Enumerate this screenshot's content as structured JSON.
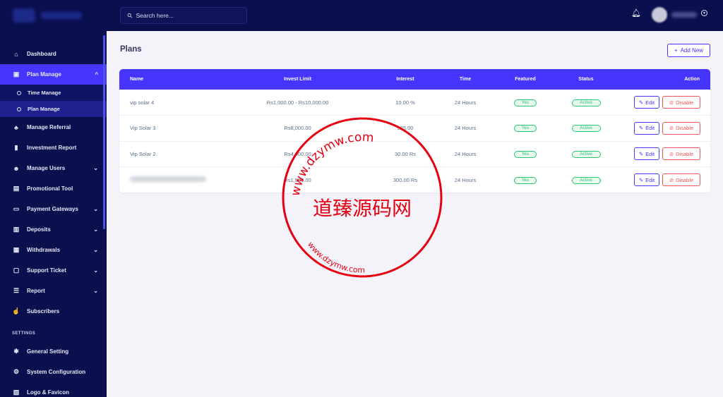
{
  "sidebar": {
    "items": [
      {
        "label": "Dashboard",
        "icon": "home-icon",
        "glyph": "⌂"
      },
      {
        "label": "Plan Manage",
        "icon": "clipboard-icon",
        "glyph": "▣",
        "caret": "^"
      },
      {
        "label": "Manage Referral",
        "icon": "tree-icon",
        "glyph": "♣"
      },
      {
        "label": "Investment Report",
        "icon": "chart-bars-icon",
        "glyph": "▮"
      },
      {
        "label": "Manage Users",
        "icon": "users-icon",
        "glyph": "☻",
        "caret": "⌄"
      },
      {
        "label": "Promotional Tool",
        "icon": "ad-icon",
        "glyph": "▤"
      },
      {
        "label": "Payment Gateways",
        "icon": "credit-card-icon",
        "glyph": "▭",
        "caret": "⌄"
      },
      {
        "label": "Deposits",
        "icon": "file-invoice-icon",
        "glyph": "▥",
        "caret": "⌄"
      },
      {
        "label": "Withdrawals",
        "icon": "bank-icon",
        "glyph": "▦",
        "caret": "⌄"
      },
      {
        "label": "Support Ticket",
        "icon": "ticket-icon",
        "glyph": "▢",
        "caret": "⌄"
      },
      {
        "label": "Report",
        "icon": "list-icon",
        "glyph": "☰",
        "caret": "⌄"
      },
      {
        "label": "Subscribers",
        "icon": "thumbs-up-icon",
        "glyph": "☝"
      }
    ],
    "submenu": [
      {
        "label": "Time Manage"
      },
      {
        "label": "Plan Manage"
      }
    ],
    "settings_label": "SETTINGS",
    "settings": [
      {
        "label": "General Setting",
        "icon": "gear-icon",
        "glyph": "✱"
      },
      {
        "label": "System Configuration",
        "icon": "cog-icon",
        "glyph": "⚙"
      },
      {
        "label": "Logo & Favicon",
        "icon": "image-icon",
        "glyph": "▧"
      }
    ]
  },
  "topbar": {
    "search_placeholder": "Search here...",
    "search_icon": "search-icon",
    "bell_icon": "bell-icon"
  },
  "page": {
    "title": "Plans",
    "add_new_label": "Add New",
    "add_new_icon": "plus-icon"
  },
  "table": {
    "headers": {
      "name": "Name",
      "invest_limit": "Invest Limit",
      "interest": "Interest",
      "time": "Time",
      "featured": "Featured",
      "status": "Status",
      "action": "Action"
    },
    "rows": [
      {
        "name": "vip solar 4",
        "invest_limit": "Rs1,000.00 - Rs10,000.00",
        "interest": "10.00 %",
        "time": "24 Hours",
        "featured": "Yes",
        "status": "Active",
        "edit": "Edit",
        "disable": "Disable"
      },
      {
        "name": "Vip Solar 3",
        "invest_limit": "Rs8,000.00",
        "interest": "325.00",
        "time": "24 Hours",
        "featured": "Yes",
        "status": "Active",
        "edit": "Edit",
        "disable": "Disable"
      },
      {
        "name": "Vip Solar 2",
        "invest_limit": "Rs4,000.00",
        "interest": "30.00 Rs",
        "time": "24 Hours",
        "featured": "Yes",
        "status": "Active",
        "edit": "Edit",
        "disable": "Disable"
      },
      {
        "name": "",
        "invest_limit": "Rs1,500.00",
        "interest": "300.00 Rs",
        "time": "24 Hours",
        "featured": "Yes",
        "status": "Active",
        "edit": "Edit",
        "disable": "Disable"
      }
    ]
  },
  "watermark": {
    "center_text": "道臻源码网",
    "ring_text": "www.dzymw.com",
    "color": "#e60012"
  },
  "colors": {
    "sidebar_bg": "#0a0f4e",
    "accent": "#4634ff",
    "success": "#28c76f",
    "danger": "#ea5455"
  }
}
